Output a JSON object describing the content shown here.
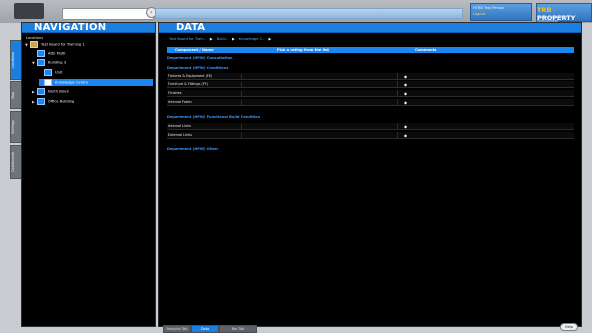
{
  "topbar": {
    "search_placeholder": "",
    "user": {
      "line1": "HTRB Test Person",
      "line2": "Logout"
    },
    "brand": {
      "prefix": "TRB",
      "name": "PROPERTY",
      "tagline": "SMARTER PROPERTY MANAGEMENT"
    }
  },
  "side_tabs": [
    "Locations",
    "Map",
    "Settings",
    "Dashboards"
  ],
  "nav": {
    "title": "NAVIGATION",
    "locations_label": "Locations",
    "tree": [
      {
        "label": "Test Board for Training 1",
        "toggle": "▼",
        "selected": false
      },
      {
        "label": "ADE Multi",
        "toggle": "",
        "selected": false
      },
      {
        "label": "Building 3",
        "toggle": "▼",
        "selected": false
      },
      {
        "label": "Unit",
        "toggle": "",
        "selected": false
      },
      {
        "label": "Knowledge Centre",
        "toggle": "",
        "selected": true
      },
      {
        "label": "North Block",
        "toggle": "▶",
        "selected": false
      },
      {
        "label": "Office Building",
        "toggle": "▶",
        "selected": false
      }
    ]
  },
  "data": {
    "title": "DATA",
    "breadcrumb": [
      "Test Board for Train..",
      "Build..",
      "Knowledge C..",
      ""
    ],
    "columns": {
      "component": "Component / Name",
      "rating": "Pick a rating from the list",
      "comments": "Comments"
    },
    "sections": [
      {
        "title": "Department (HPW) Consultation",
        "rows": []
      },
      {
        "title": "Department (HPW) Conditions",
        "rows": [
          "Fixtures & Equipment (FE)",
          "Furniture & Fittings (FF)",
          "Finishes",
          "Internal Fabric"
        ]
      },
      {
        "title": "Department (HPW) Functional Build Condition",
        "rows": [
          "Internal Links",
          "External Links"
        ]
      },
      {
        "title": "Department (HPW) Other",
        "rows": []
      }
    ],
    "dropdown_glyph": "◆"
  },
  "bottom_tabs": [
    {
      "label": "Analysis Tab",
      "active": false
    },
    {
      "label": "Data",
      "active": true
    },
    {
      "label": "Bar Tab",
      "active": false
    }
  ],
  "help_label": "Help"
}
